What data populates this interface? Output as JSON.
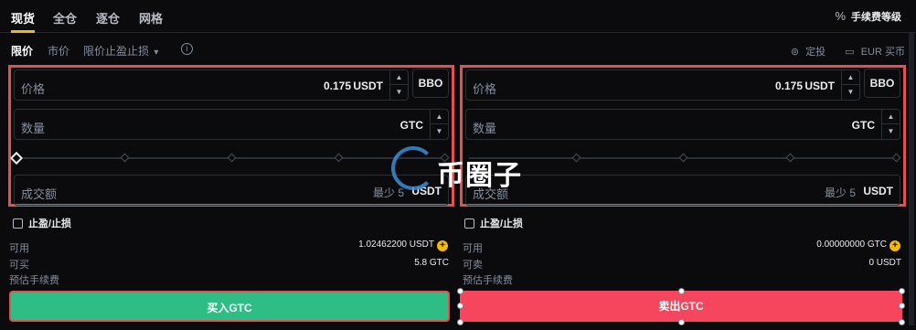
{
  "top_tabs": [
    "现货",
    "全仓",
    "逐仓",
    "网格"
  ],
  "fee_level": {
    "icon": "percent-icon",
    "symbol": "%",
    "label": "手续费等级"
  },
  "order_types": {
    "limit": "限价",
    "market": "市价",
    "stop_limit": "限价止盈止损",
    "dropdown_arrow": "▾",
    "info": "i"
  },
  "top_links": {
    "auto_invest": "定投",
    "buy_eur": "EUR 买币"
  },
  "buy_panel": {
    "price_label": "价格",
    "price_value": "0.175",
    "price_unit": "USDT",
    "bbo": "BBO",
    "amount_label": "数量",
    "amount_unit": "GTC",
    "total_label": "成交额",
    "total_min": "最少 5",
    "total_unit": "USDT",
    "tpsl": "止盈/止损",
    "available_label": "可用",
    "available_value": "1.02462200 USDT",
    "max_label": "可买",
    "max_value": "5.8 GTC",
    "fee_label": "预估手续费",
    "button": "买入GTC"
  },
  "sell_panel": {
    "price_label": "价格",
    "price_value": "0.175",
    "price_unit": "USDT",
    "bbo": "BBO",
    "amount_label": "数量",
    "amount_unit": "GTC",
    "total_label": "成交额",
    "total_min": "最少 5",
    "total_unit": "USDT",
    "tpsl": "止盈/止损",
    "available_label": "可用",
    "available_value": "0.00000000 GTC",
    "max_label": "可卖",
    "max_value": "0 USDT",
    "fee_label": "预估手续费",
    "button": "卖出GTC"
  },
  "watermark": "币圈子",
  "colors": {
    "buy": "#2ebd85",
    "sell": "#f6465d",
    "accent": "#f0b90b",
    "highlight_border": "#e2514f"
  }
}
